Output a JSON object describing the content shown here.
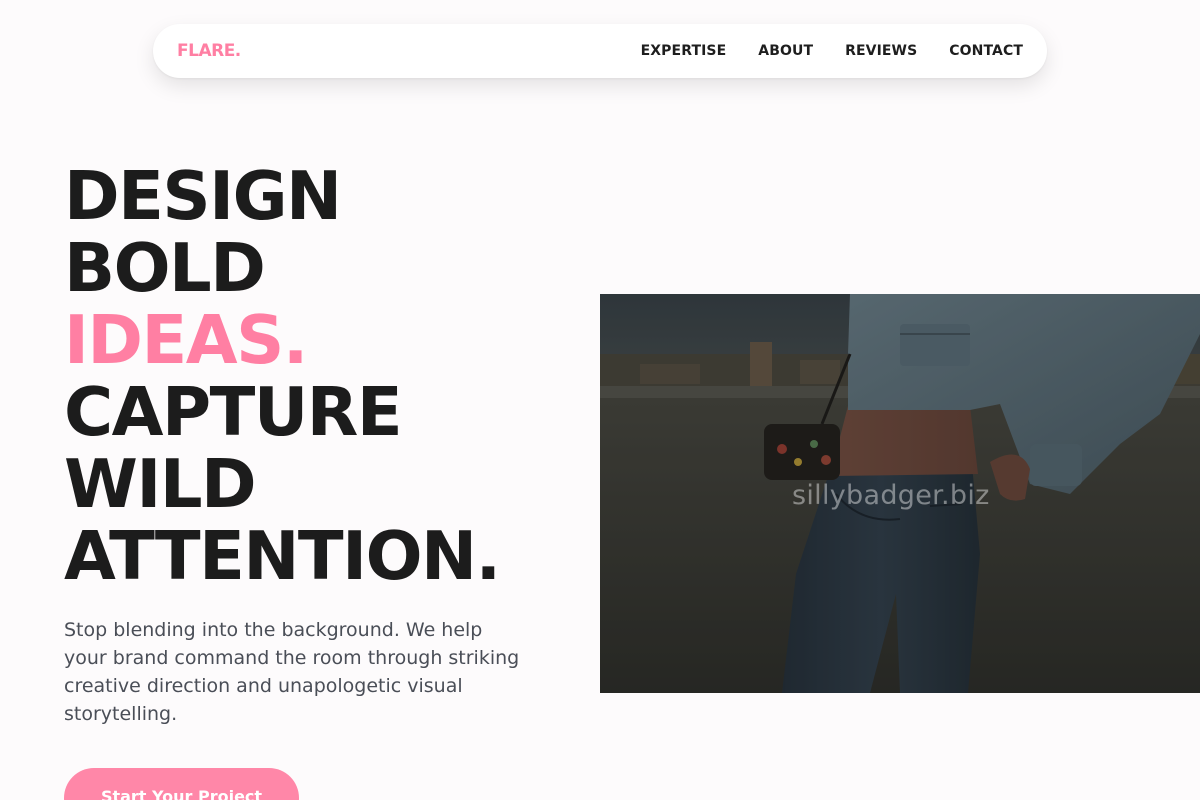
{
  "nav": {
    "logo": "FLARE.",
    "links": [
      "EXPERTISE",
      "ABOUT",
      "REVIEWS",
      "CONTACT"
    ]
  },
  "hero": {
    "headline_lines": [
      "DESIGN",
      "BOLD",
      "IDEAS.",
      "CAPTURE",
      "WILD",
      "ATTENTION."
    ],
    "accent_line_index": 2,
    "subtext": "Stop blending into the background. We help your brand command the room through striking creative direction and unapologetic visual storytelling.",
    "cta_label": "Start Your Project"
  },
  "image": {
    "watermark": "sillybadger.biz"
  },
  "colors": {
    "accent": "#ff7fa3",
    "text_dark": "#1c1c1c",
    "text_muted": "#4a4e57",
    "background": "#fdfbfc"
  }
}
